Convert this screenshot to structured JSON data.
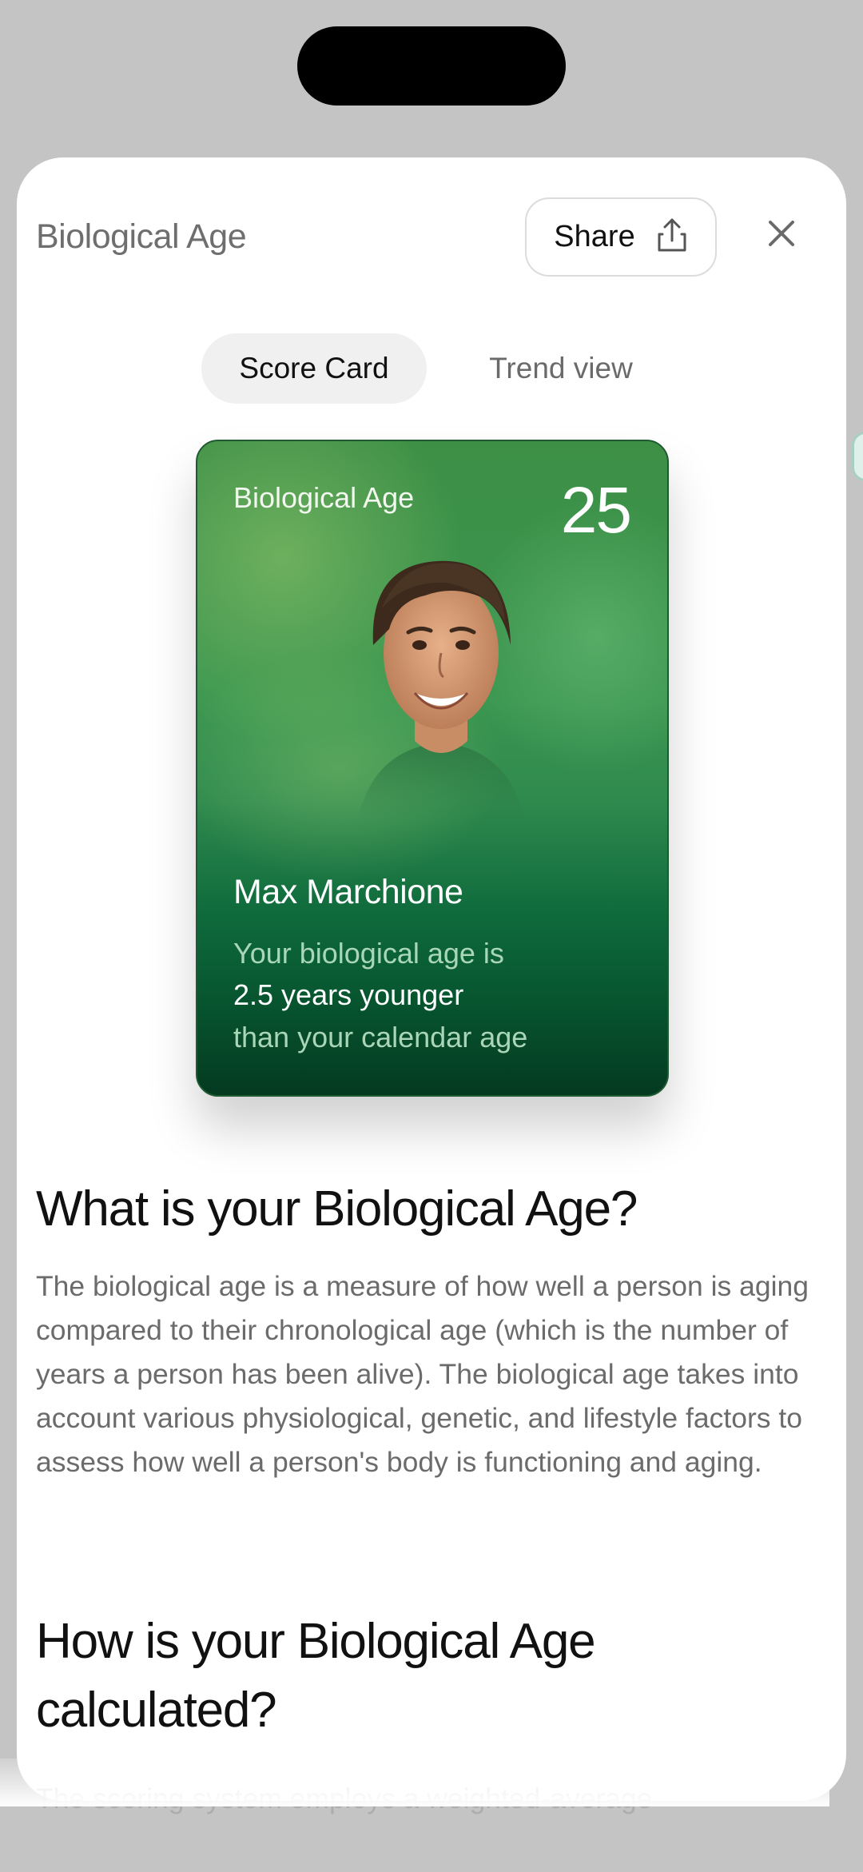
{
  "header": {
    "title": "Biological Age",
    "share_label": "Share",
    "share_icon": "share-icon",
    "close_icon": "close-icon"
  },
  "tabs": [
    {
      "label": "Score Card",
      "active": true
    },
    {
      "label": "Trend view",
      "active": false
    }
  ],
  "score_card": {
    "label": "Biological Age",
    "score": "25",
    "name": "Max Marchione",
    "line1": "Your biological age is",
    "line2": "2.5 years younger",
    "line3": "than your calendar age",
    "accent_color": "#0f6b3c"
  },
  "sections": [
    {
      "heading": "What is your Biological Age?",
      "body": "The biological age is a measure of how well a person is aging compared to their chronological age (which is the number of years a person has been alive). The biological age takes into account various physiological, genetic, and lifestyle factors to assess how well a person's body is functioning and aging."
    },
    {
      "heading": "How is your Biological Age calculated?",
      "body_preview": "The scoring system employs a weighted-average"
    }
  ]
}
